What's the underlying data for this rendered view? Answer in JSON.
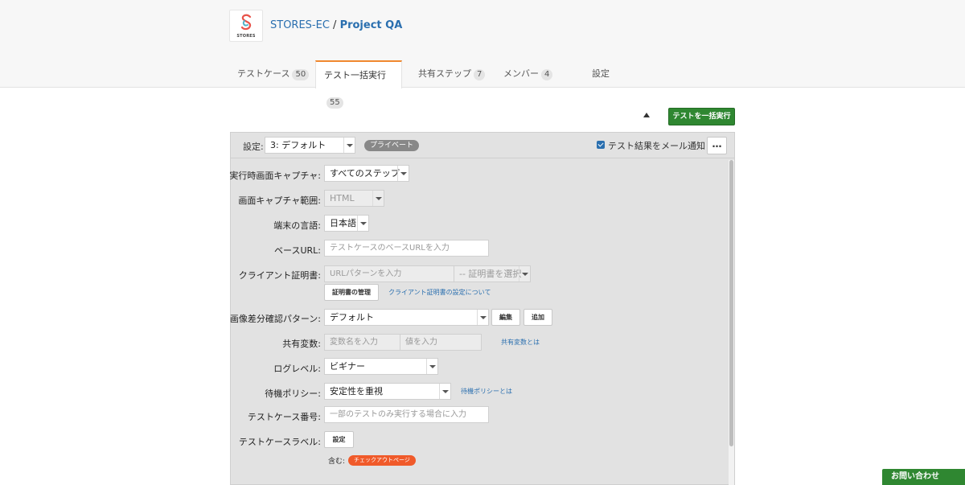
{
  "header": {
    "logo_text": "STORES",
    "org": "STORES-EC",
    "separator": " / ",
    "project": "Project QA"
  },
  "tabs": [
    {
      "label": "テストケース",
      "count": "50",
      "active": false
    },
    {
      "label": "テスト一括実行",
      "count": "55",
      "active": true
    },
    {
      "label": "共有ステップ",
      "count": "7",
      "active": false
    },
    {
      "label": "メンバー",
      "count": "4",
      "active": false
    },
    {
      "label": "設定",
      "count": "",
      "active": false
    }
  ],
  "toolbar": {
    "run_button": "テストを一括実行"
  },
  "settings_header": {
    "label": "設定:",
    "selected": "3: デフォルト",
    "private_badge": "プライベート",
    "notify_checked": true,
    "notify_label": "テスト結果をメール通知",
    "more_label": "…"
  },
  "form": {
    "capture": {
      "label": "実行時画面キャプチャ:",
      "value": "すべてのステップ"
    },
    "capture_range": {
      "label": "画面キャプチャ範囲:",
      "value": "HTML"
    },
    "language": {
      "label": "端末の言語:",
      "value": "日本語"
    },
    "base_url": {
      "label": "ベースURL:",
      "placeholder": "テストケースのベースURLを入力"
    },
    "client_cert": {
      "label": "クライアント証明書:",
      "url_placeholder": "URLパターンを入力",
      "cert_select": "-- 証明書を選択 --",
      "manage_button": "証明書の管理",
      "help_link": "クライアント証明書の設定について"
    },
    "image_diff": {
      "label": "画像差分確認パターン:",
      "value": "デフォルト",
      "edit_button": "編集",
      "add_button": "追加"
    },
    "shared_vars": {
      "label": "共有変数:",
      "name_placeholder": "変数名を入力",
      "value_placeholder": "値を入力",
      "help_link": "共有変数とは"
    },
    "log_level": {
      "label": "ログレベル:",
      "value": "ビギナー"
    },
    "wait_policy": {
      "label": "待機ポリシー:",
      "value": "安定性を重視",
      "help_link": "待機ポリシーとは"
    },
    "test_case_number": {
      "label": "テストケース番号:",
      "placeholder": "一部のテストのみ実行する場合に入力"
    },
    "test_case_label": {
      "label": "テストケースラベル:",
      "set_button": "設定",
      "includes_label": "含む:",
      "tag": "チェックアウトページ"
    }
  },
  "contact_button": "お問い合わせ"
}
